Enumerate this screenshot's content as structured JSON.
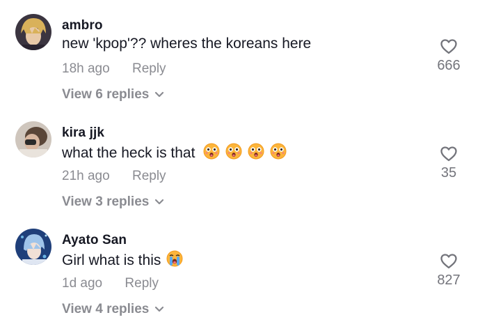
{
  "comments": [
    {
      "username": "ambro",
      "text": "new 'kpop'?? wheres the koreans here",
      "time": "18h ago",
      "reply_label": "Reply",
      "view_replies": "View 6 replies",
      "likes": "666",
      "avatar_colors": {
        "bg": "#3b3540",
        "hair": "#d9b15a",
        "skin": "#e8c9a8"
      }
    },
    {
      "username": "kira jjk",
      "text": "what the heck is that",
      "time": "21h ago",
      "reply_label": "Reply",
      "view_replies": "View 3 replies",
      "likes": "35",
      "emojis": [
        "astonished-face",
        "astonished-face",
        "astonished-face",
        "astonished-face"
      ],
      "avatar_colors": {
        "bg": "#cfc6bd",
        "hair": "#5a4638",
        "skin": "#d8b7a0"
      }
    },
    {
      "username": "Ayato San",
      "text": "Girl what is this",
      "time": "1d ago",
      "reply_label": "Reply",
      "view_replies": "View 4 replies",
      "likes": "827",
      "emojis": [
        "crying-face"
      ],
      "avatar_colors": {
        "bg": "#1f3f7a",
        "hair": "#9fc4ea",
        "skin": "#f1e0d6"
      }
    }
  ],
  "colors": {
    "secondary_text": "#8a8b91",
    "like_icon": "#73747b",
    "primary_text": "#161823"
  }
}
